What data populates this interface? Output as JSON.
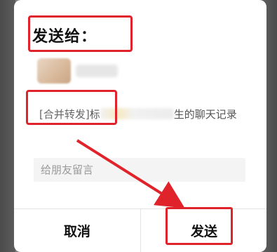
{
  "dialog": {
    "title": "发送给：",
    "recipient": {
      "avatar_icon": "contact-avatar"
    },
    "preview": {
      "tag": "[合并转发]",
      "prefix": "标",
      "suffix": "生的聊天记录"
    },
    "message": {
      "placeholder": "给朋友留言",
      "value": ""
    },
    "buttons": {
      "cancel": "取消",
      "send": "发送"
    }
  },
  "colors": {
    "highlight": "#e0232b",
    "overlay": "#7a7a7a"
  }
}
